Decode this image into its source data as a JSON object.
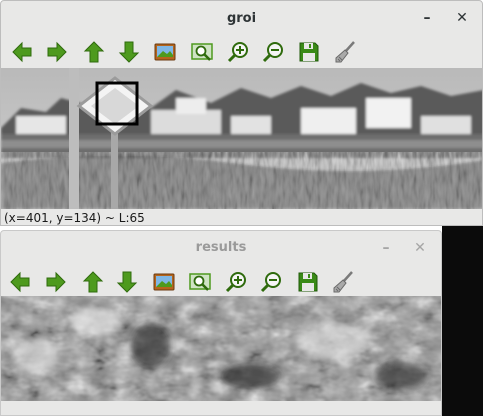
{
  "windows": {
    "groi": {
      "title": "groi",
      "minimize_icon": "minimize-icon",
      "close_icon": "close-icon",
      "status_text": "(x=401, y=134) ~ L:65"
    },
    "results": {
      "title": "results",
      "minimize_icon": "minimize-icon",
      "close_icon": "close-icon"
    }
  },
  "toolbar": {
    "icons": [
      "arrow-left-icon",
      "arrow-right-icon",
      "arrow-up-icon",
      "arrow-down-icon",
      "image-icon",
      "zoom-rect-icon",
      "zoom-in-icon",
      "zoom-out-icon",
      "save-icon",
      "brush-icon"
    ]
  },
  "colors": {
    "arrow_green": "#4e9a1e",
    "save_green": "#3a8a17",
    "window_bg": "#e8e8e7",
    "roi_box": "#000000"
  }
}
